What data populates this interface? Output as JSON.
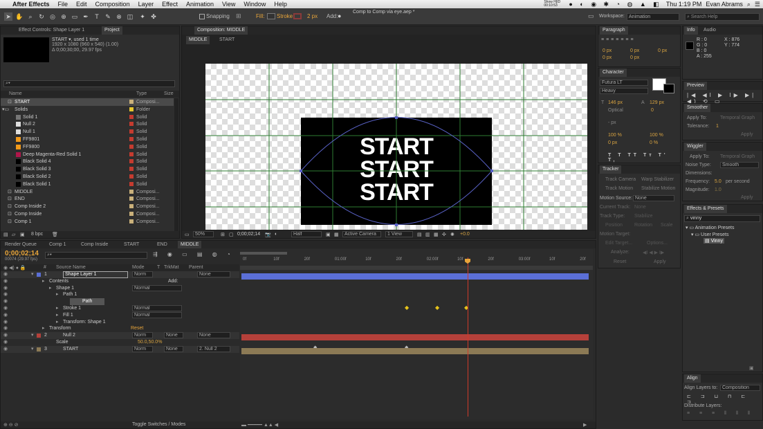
{
  "menubar": {
    "apple": "",
    "app": "After Effects",
    "items": [
      "File",
      "Edit",
      "Composition",
      "Layer",
      "Effect",
      "Animation",
      "View",
      "Window",
      "Help"
    ],
    "clock": "Thu 1:19 PM",
    "user": "Evan Abrams",
    "battery_label": "Show H|ID\n00:10:53"
  },
  "toolbar": {
    "snapping": "Snapping",
    "fill": "Fill:",
    "stroke": "Stroke:",
    "stroke_px": "2 px",
    "add": "Add:",
    "title": "Comp to Comp via eye.aep *",
    "workspace_label": "Workspace:",
    "workspace": "Animation",
    "search_placeholder": "Search Help"
  },
  "project": {
    "tab1": "Effect Controls: Shape Layer 1",
    "tab2": "Project",
    "item_name": "START ▾, used 1 time",
    "item_dims": "1920 x 1080 (960 x 540) (1.00)",
    "item_dur": "Δ 0;00;30;00, 29.97 fps",
    "col_name": "Name",
    "col_type": "Type",
    "col_size": "Size",
    "bpc": "8 bpc",
    "items": [
      {
        "name": "START",
        "type": "Composi...",
        "color": "#c9b07a",
        "indent": 0,
        "kind": "comp",
        "sel": true
      },
      {
        "name": "Solids",
        "type": "Folder",
        "color": "#e6c62e",
        "indent": 0,
        "kind": "folder"
      },
      {
        "name": "Solid 1",
        "type": "Solid",
        "color": "#c43b2f",
        "indent": 1,
        "kind": "solid",
        "swatch": "#777"
      },
      {
        "name": "Null 2",
        "type": "Solid",
        "color": "#c43b2f",
        "indent": 1,
        "kind": "solid",
        "swatch": "#ddd"
      },
      {
        "name": "Null 1",
        "type": "Solid",
        "color": "#c43b2f",
        "indent": 1,
        "kind": "solid",
        "swatch": "#ddd"
      },
      {
        "name": "FF9801",
        "type": "Solid",
        "color": "#c43b2f",
        "indent": 1,
        "kind": "solid",
        "swatch": "#f29a1a"
      },
      {
        "name": "FF9800",
        "type": "Solid",
        "color": "#c43b2f",
        "indent": 1,
        "kind": "solid",
        "swatch": "#f29a1a"
      },
      {
        "name": "Deep Magenta-Red Solid 1",
        "type": "Solid",
        "color": "#c43b2f",
        "indent": 1,
        "kind": "solid",
        "swatch": "#b0164a"
      },
      {
        "name": "Black Solid 4",
        "type": "Solid",
        "color": "#c43b2f",
        "indent": 1,
        "kind": "solid",
        "swatch": "#000"
      },
      {
        "name": "Black Solid 3",
        "type": "Solid",
        "color": "#c43b2f",
        "indent": 1,
        "kind": "solid",
        "swatch": "#000"
      },
      {
        "name": "Black Solid 2",
        "type": "Solid",
        "color": "#c43b2f",
        "indent": 1,
        "kind": "solid",
        "swatch": "#000"
      },
      {
        "name": "Black Solid 1",
        "type": "Solid",
        "color": "#c43b2f",
        "indent": 1,
        "kind": "solid",
        "swatch": "#000"
      },
      {
        "name": "MIDDLE",
        "type": "Composi...",
        "color": "#c9b07a",
        "indent": 0,
        "kind": "comp"
      },
      {
        "name": "END",
        "type": "Composi...",
        "color": "#c9b07a",
        "indent": 0,
        "kind": "comp"
      },
      {
        "name": "Comp Inside 2",
        "type": "Composi...",
        "color": "#c9b07a",
        "indent": 0,
        "kind": "comp"
      },
      {
        "name": "Comp Inside",
        "type": "Composi...",
        "color": "#c9b07a",
        "indent": 0,
        "kind": "comp"
      },
      {
        "name": "Comp 1",
        "type": "Composi...",
        "color": "#c9b07a",
        "indent": 0,
        "kind": "comp"
      }
    ]
  },
  "comp": {
    "tab": "Composition: MIDDLE",
    "crumb1": "MIDDLE",
    "crumb2": "START",
    "text_lines": [
      "START",
      "START",
      "START"
    ],
    "zoom": "50%",
    "timecode": "0;00;02;14",
    "res": "Half",
    "camera": "Active Camera",
    "views": "1 View",
    "exposure": "+0.0"
  },
  "paragraph": {
    "tab": "Paragraph",
    "f1": "0 px",
    "f2": "0 px",
    "f3": "0 px",
    "f4": "0 px",
    "f5": "0 px"
  },
  "character": {
    "tab": "Character",
    "font": "Futura LT",
    "style": "Heavy",
    "size": "146 px",
    "leading": "129 px",
    "kern": "Optical",
    "track": "0",
    "indent": "- px",
    "vscale": "100 %",
    "hscale": "100 %",
    "baseline": "0 px",
    "tsume": "0 %"
  },
  "tracker": {
    "tab": "Tracker",
    "track_camera": "Track Camera",
    "warp": "Warp Stabilizer",
    "track_motion": "Track Motion",
    "stabilize": "Stabilize Motion",
    "motion_source_label": "Motion Source:",
    "motion_source": "None",
    "current_track_label": "Current Track:",
    "current_track": "None",
    "track_type_label": "Track Type:",
    "track_type": "Stabilize",
    "position": "Position",
    "rotation": "Rotation",
    "scale": "Scale",
    "motion_target": "Motion Target:",
    "edit_target": "Edit Target...",
    "options": "Options...",
    "analyze": "Analyze:",
    "reset": "Reset",
    "apply": "Apply"
  },
  "info": {
    "tab1": "Info",
    "tab2": "Audio",
    "r": "R : 0",
    "g": "G : 0",
    "b": "B : 0",
    "a": "A : 255",
    "x": "X : 876",
    "y": "Y : 774"
  },
  "preview": {
    "tab": "Preview"
  },
  "smoother": {
    "tab": "Smoother",
    "apply_to_label": "Apply To:",
    "apply_to": "Temporal Graph",
    "tolerance_label": "Tolerance:",
    "tolerance": "1",
    "apply": "Apply"
  },
  "wiggler": {
    "tab": "Wiggler",
    "apply_to_label": "Apply To:",
    "apply_to": "Temporal Graph",
    "noise_label": "Noise Type:",
    "noise": "Smooth",
    "dimensions_label": "Dimensions:",
    "freq_label": "Frequency:",
    "freq": "5.0",
    "freq_unit": "per second",
    "mag_label": "Magnitude:",
    "mag": "1.0",
    "apply": "Apply"
  },
  "effects": {
    "tab": "Effects & Presets",
    "search": "vinny",
    "tree": [
      "Animation Presets",
      "User Presets",
      "Vinny"
    ]
  },
  "align": {
    "tab": "Align",
    "align_to_label": "Align Layers to:",
    "align_to": "Composition",
    "distribute": "Distribute Layers:"
  },
  "timeline": {
    "tabs": [
      "Render Queue",
      "Comp 1",
      "Comp Inside",
      "START",
      "END",
      "MIDDLE"
    ],
    "timecode": "0;00;02;14",
    "frames": "00074 (29.97 fps)",
    "col_source": "Source Name",
    "col_mode": "Mode",
    "col_t": "T",
    "col_trkmat": "TrkMat",
    "col_parent": "Parent",
    "toggle": "Toggle Switches / Modes",
    "ruler": [
      "0f",
      "10f",
      "20f",
      "01:00f",
      "10f",
      "20f",
      "02:00f",
      "10f",
      "20f",
      "03:00f",
      "10f",
      "20f"
    ],
    "layers": [
      {
        "label": "1",
        "name": "Shape Layer 1",
        "indent": 0,
        "mode": "Norm",
        "parent": "None",
        "type": "layer",
        "sel": true
      },
      {
        "label": "",
        "name": "Contents",
        "indent": 1,
        "type": "group",
        "add": "Add:"
      },
      {
        "label": "",
        "name": "Shape 1",
        "indent": 2,
        "mode": "Normal",
        "type": "group"
      },
      {
        "label": "",
        "name": "Path 1",
        "indent": 3,
        "type": "group"
      },
      {
        "label": "",
        "name": "Path",
        "indent": 4,
        "type": "prop",
        "sel": true
      },
      {
        "label": "",
        "name": "Stroke 1",
        "indent": 3,
        "mode": "Normal",
        "type": "group"
      },
      {
        "label": "",
        "name": "Fill 1",
        "indent": 3,
        "mode": "Normal",
        "type": "group"
      },
      {
        "label": "",
        "name": "Transform: Shape 1",
        "indent": 3,
        "type": "group"
      },
      {
        "label": "",
        "name": "Transform",
        "indent": 1,
        "reset": "Reset",
        "type": "group"
      },
      {
        "label": "2",
        "name": "Null 2",
        "indent": 0,
        "mode": "Norm",
        "trkmat": "None",
        "parent": "None",
        "type": "layer"
      },
      {
        "label": "",
        "name": "Scale",
        "indent": 2,
        "value": "50.0,50.0%",
        "type": "prop"
      },
      {
        "label": "3",
        "name": "START",
        "indent": 0,
        "mode": "Norm",
        "trkmat": "None",
        "parent": "2. Null 2",
        "type": "layer"
      }
    ]
  },
  "colors": {
    "accent": "#e8a53a",
    "layer1": "#5b6fd6",
    "layer2": "#b5403a",
    "layer3": "#8c7a55",
    "grid": "#2e7d32",
    "path": "#5a63c8"
  }
}
